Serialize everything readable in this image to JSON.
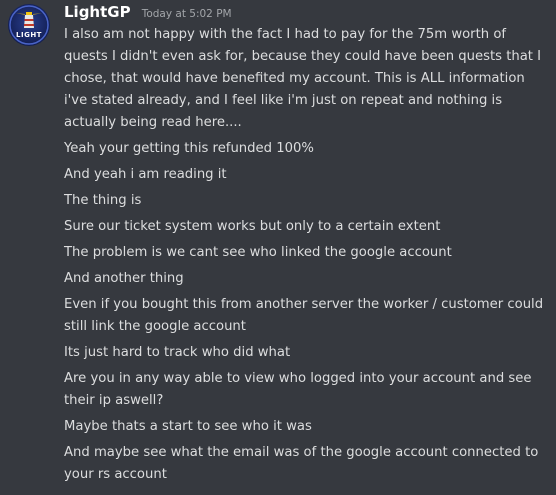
{
  "author": {
    "username": "LightGP",
    "timestamp": "Today at 5:02 PM",
    "avatar_text": "LIGHT"
  },
  "messages": [
    "I also am not happy with the fact I had to pay for the 75m worth of quests I didn't even ask for, because they could have been quests that I chose, that would have benefited my account. This is ALL information i've stated already, and I feel like i'm just on repeat and nothing is actually being read here....",
    "Yeah your getting this refunded 100%",
    "And yeah i am reading it",
    "The thing is",
    "Sure our ticket system works but only to a certain extent",
    "The problem is we cant see who linked the google account",
    "And another thing",
    "Even if you bought this from another server the worker / customer could still link the google account",
    "Its just hard to track who did what",
    "Are you in any way able to view who logged into your account and see their ip aswell?",
    "Maybe thats a start to see who it was",
    "And maybe see what the email was of the google account connected to your rs account"
  ],
  "colors": {
    "background": "#36393f",
    "username": "#ffffff",
    "timestamp": "#a3a6aa",
    "message_text": "#dcddde"
  }
}
